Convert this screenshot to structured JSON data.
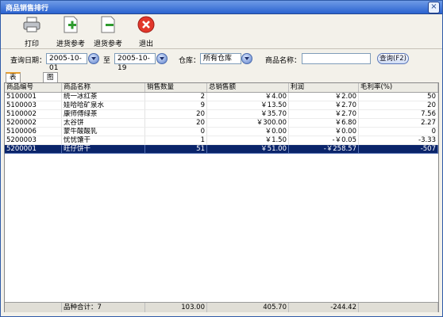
{
  "window": {
    "title": "商品销售排行",
    "close_glyph": "×"
  },
  "toolbar": [
    {
      "label": "打印",
      "icon": "printer-icon"
    },
    {
      "label": "进货参考",
      "icon": "add-page-icon"
    },
    {
      "label": "退货参考",
      "icon": "remove-page-icon"
    },
    {
      "label": "退出",
      "icon": "close-circle-icon"
    }
  ],
  "filters": {
    "date_label": "查询日期：",
    "date_from": "2005-10-01",
    "to_label": "至",
    "date_to": "2005-10-19",
    "warehouse_label": "仓库：",
    "warehouse": "所有仓库",
    "product_label": "商品名称：",
    "product_name": "",
    "query_button": "查询(F2)"
  },
  "tabs": [
    {
      "label": "表格显示",
      "active": true
    },
    {
      "label": "图表显示",
      "active": false
    }
  ],
  "table": {
    "columns": [
      "商品编号",
      "商品名称",
      "销售数量",
      "总销售额",
      "利润",
      "毛利率(%)"
    ],
    "rows": [
      [
        "5100001",
        "统一冰红茶",
        "2",
        "￥4.00",
        "￥2.00",
        "50"
      ],
      [
        "5100003",
        "娃哈哈矿泉水",
        "9",
        "￥13.50",
        "￥2.70",
        "20"
      ],
      [
        "5100002",
        "康师傅绿茶",
        "20",
        "￥35.70",
        "￥2.70",
        "7.56"
      ],
      [
        "5200002",
        "太谷饼",
        "20",
        "￥300.00",
        "￥6.80",
        "2.27"
      ],
      [
        "5100006",
        "蒙牛酸酸乳",
        "0",
        "￥0.00",
        "￥0.00",
        "0"
      ],
      [
        "5200003",
        "忧忧馕干",
        "1",
        "￥1.50",
        "-￥0.05",
        "-3.33"
      ],
      [
        "5200001",
        "旺仔饼干",
        "51",
        "￥51.00",
        "-￥258.57",
        "-507"
      ]
    ],
    "selected_row": 6
  },
  "footer": {
    "count_label": "品种合计：7",
    "qty_total": "103.00",
    "sales_total": "405.70",
    "profit_total": "-244.42"
  },
  "colors": {
    "title_bar": "#2b63d0",
    "selection": "#0a246a",
    "active_tab": "#e59d2e"
  }
}
